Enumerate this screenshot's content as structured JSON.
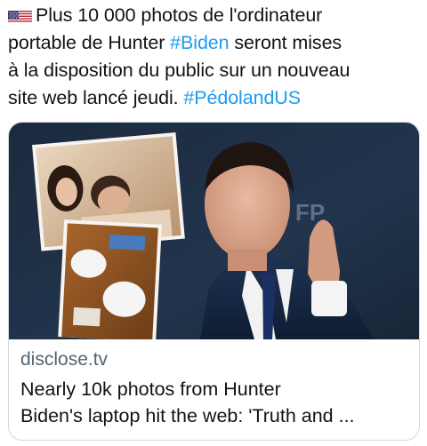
{
  "tweet": {
    "flag_icon": "us-flag-icon",
    "line1": "Plus 10 000 photos de l'ordinateur",
    "line2_before": "portable de Hunter ",
    "hashtag1": "#Biden",
    "line2_after": " seront mises",
    "line3": "à la disposition du public sur un nouveau",
    "line4_before": "site web lancé jeudi. ",
    "hashtag2": "#PédolandUS"
  },
  "card": {
    "domain": "disclose.tv",
    "headline": "Nearly 10k photos from Hunter\nBiden's laptop hit the web: 'Truth and ..."
  },
  "colors": {
    "hashtag": "#1d9bf0",
    "text": "#0f1419",
    "secondary": "#536471",
    "border": "#cfd9de"
  }
}
